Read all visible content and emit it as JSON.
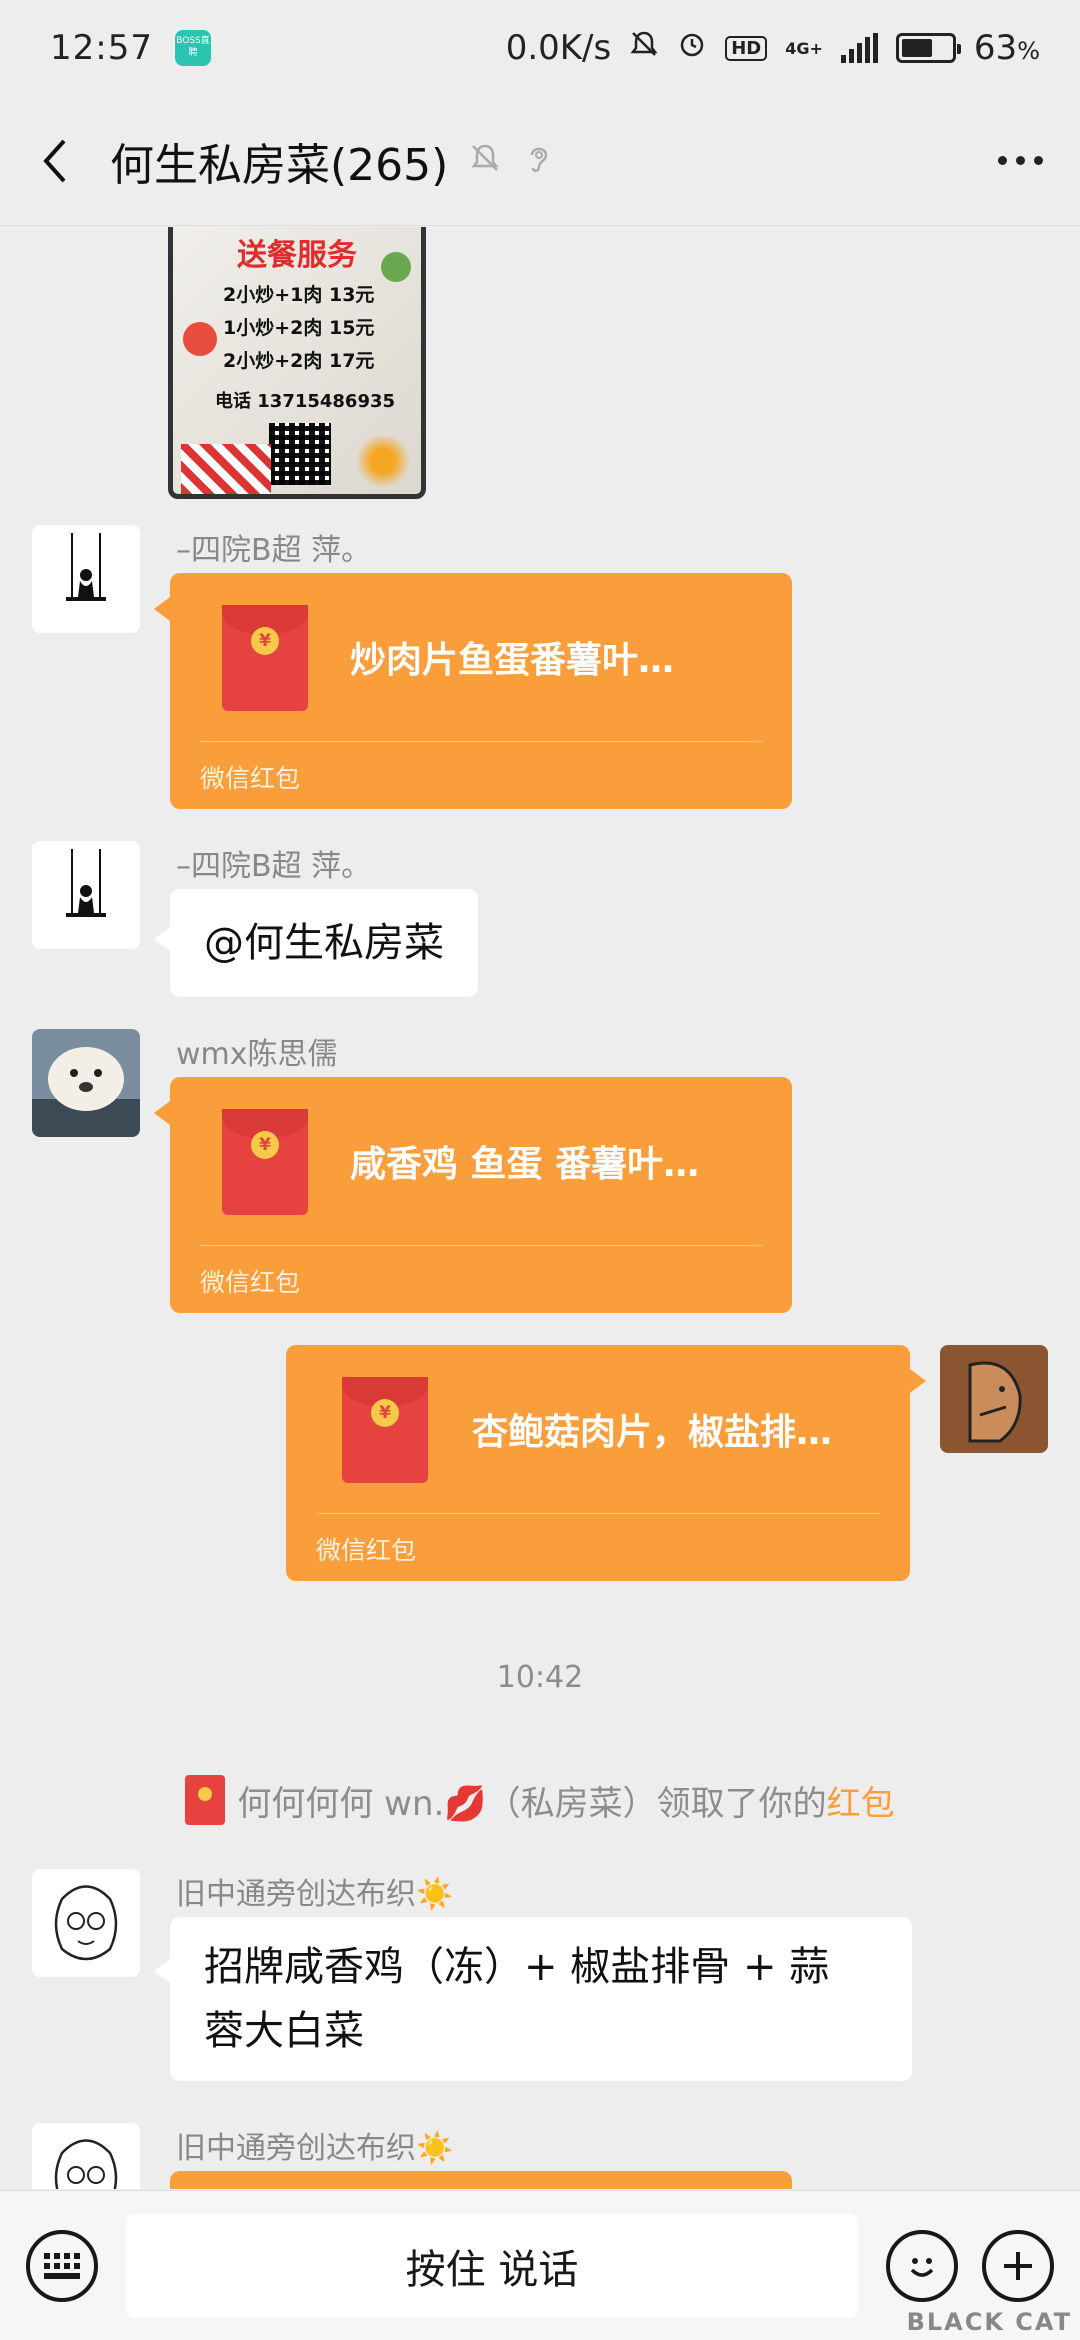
{
  "status_bar": {
    "time": "12:57",
    "net_speed": "0.0K/s",
    "network": "4G+",
    "battery": "63",
    "battery_unit": "%",
    "hd": "HD",
    "boss_badge": "BOSS直聘"
  },
  "header": {
    "title": "何生私房菜(265)"
  },
  "poster": {
    "title": "送餐服务",
    "rows": [
      "2小炒+1肉    13元",
      "1小炒+2肉    15元",
      "2小炒+2肉    17元"
    ],
    "phone": "电话 13715486935"
  },
  "messages": {
    "m1": {
      "sender": "–四院B超  萍。",
      "packet_text": "炒肉片鱼蛋番薯叶…",
      "packet_label": "微信红包"
    },
    "m2": {
      "sender": "–四院B超  萍。",
      "text": "@何生私房菜"
    },
    "m3": {
      "sender": "wmx陈思儒",
      "packet_text": "咸香鸡 鱼蛋 番薯叶…",
      "packet_label": "微信红包"
    },
    "m4": {
      "packet_text": "杏鲍菇肉片，椒盐排…",
      "packet_label": "微信红包"
    },
    "timestamp": "10:42",
    "system": {
      "prefix": "何何何何 wn.💋（私房菜）领取了你的",
      "link": "红包"
    },
    "m5": {
      "sender": "旧中通旁创达布织☀️",
      "text_line1": "招牌咸香鸡（冻）+ 椒盐排骨 + 蒜",
      "text_line2": "蓉大白菜"
    },
    "m6": {
      "sender": "旧中通旁创达布织☀️"
    }
  },
  "input_bar": {
    "hold_to_talk": "按住 说话"
  },
  "watermark": "BLACK CAT",
  "colors": {
    "red_packet": "#fa9d3b",
    "envelope": "#e64340",
    "background": "#ededed"
  }
}
